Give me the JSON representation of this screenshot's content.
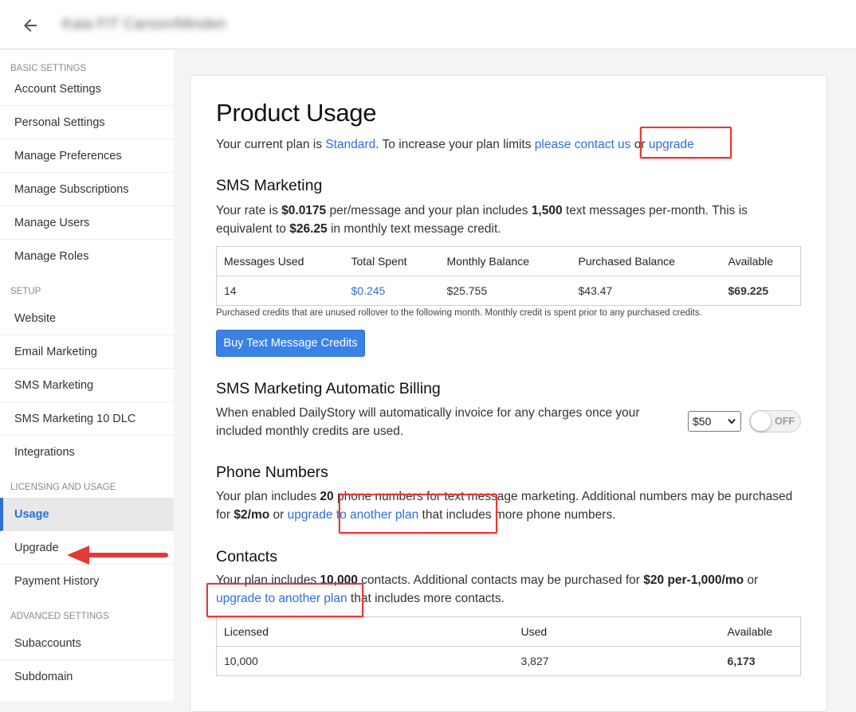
{
  "header": {
    "back_icon": "arrow-left-icon",
    "title": "Kaia FIT Carson/Minden"
  },
  "sidebar": {
    "sections": [
      {
        "title": "BASIC SETTINGS",
        "items": [
          "Account Settings",
          "Personal Settings",
          "Manage Preferences",
          "Manage Subscriptions",
          "Manage Users",
          "Manage Roles"
        ]
      },
      {
        "title": "SETUP",
        "items": [
          "Website",
          "Email Marketing",
          "SMS Marketing",
          "SMS Marketing 10 DLC",
          "Integrations"
        ]
      },
      {
        "title": "LICENSING AND USAGE",
        "items": [
          "Usage",
          "Upgrade",
          "Payment History"
        ]
      },
      {
        "title": "ADVANCED SETTINGS",
        "items": [
          "Subaccounts",
          "Subdomain"
        ]
      }
    ],
    "active_item": "Usage"
  },
  "page": {
    "title": "Product Usage",
    "plan_line": {
      "prefix": "Your current plan is ",
      "plan": "Standard",
      "mid": ". To increase your plan limits ",
      "contact": "please contact us",
      "or": " or ",
      "upgrade": "upgrade"
    }
  },
  "sms": {
    "title": "SMS Marketing",
    "rate_p1": "Your rate is ",
    "rate": "$0.0175",
    "rate_p2": " per/message and your plan includes ",
    "count": "1,500",
    "rate_p3": " text messages per-month. This is equivalent to ",
    "credit": "$26.25",
    "rate_p4": " in monthly text message credit.",
    "table": {
      "headers": [
        "Messages Used",
        "Total Spent",
        "Monthly Balance",
        "Purchased Balance",
        "Available"
      ],
      "row": [
        "14",
        "$0.245",
        "$25.755",
        "$43.47",
        "$69.225"
      ]
    },
    "note": "Purchased credits that are unused rollover to the following month. Monthly credit is spent prior to any purchased credits.",
    "buy_button": "Buy Text Message Credits"
  },
  "billing": {
    "title": "SMS Marketing Automatic Billing",
    "text": "When enabled DailyStory will automatically invoice for any charges once your included monthly credits are used.",
    "amount": "$50",
    "toggle_label": "OFF",
    "toggle_on": false
  },
  "phone": {
    "title": "Phone Numbers",
    "p1": "Your plan includes ",
    "count": "20",
    "p2": " phone numbers for text message marketing. Additional numbers may be purchased for ",
    "price": "$2/mo",
    "p3": " or ",
    "link": "upgrade to another plan",
    "p4": " that includes more phone numbers."
  },
  "contacts": {
    "title": "Contacts",
    "p1": "Your plan includes ",
    "count": "10,000",
    "p2": " contacts. Additional contacts may be purchased for ",
    "price": "$20 per-1,000/mo",
    "p3": " or ",
    "link": "upgrade to another plan",
    "p4": " that includes more contacts.",
    "table": {
      "headers": [
        "Licensed",
        "Used",
        "Available"
      ],
      "row": [
        "10,000",
        "3,827",
        "6,173"
      ]
    }
  },
  "annotations": {
    "highlight_color": "#e53935"
  }
}
